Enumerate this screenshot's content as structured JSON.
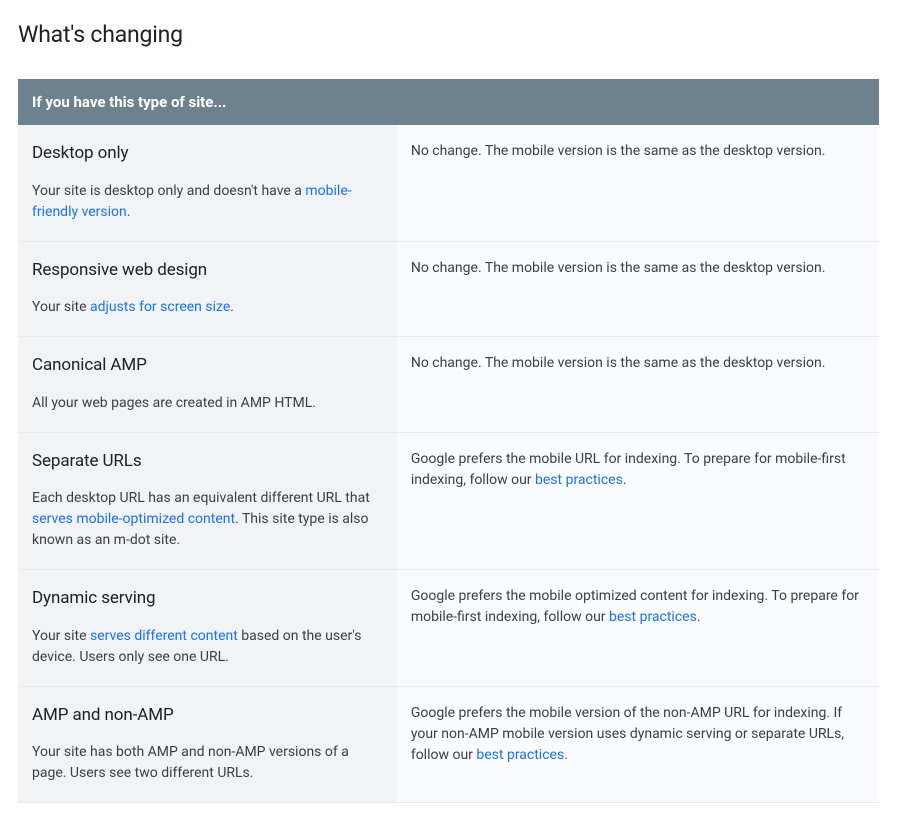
{
  "heading": "What's changing",
  "table_header": "If you have this type of site...",
  "rows": [
    {
      "title": "Desktop only",
      "desc_pre": "Your site is desktop only and doesn't have a ",
      "desc_link": "mobile-friendly version",
      "desc_post": ".",
      "right_pre": "No change. The mobile version is the same as the desktop version.",
      "right_link": "",
      "right_post": ""
    },
    {
      "title": "Responsive web design",
      "desc_pre": "Your site ",
      "desc_link": "adjusts for screen size",
      "desc_post": ".",
      "right_pre": "No change. The mobile version is the same as the desktop version.",
      "right_link": "",
      "right_post": ""
    },
    {
      "title": "Canonical AMP",
      "desc_pre": "All your web pages are created in AMP HTML.",
      "desc_link": "",
      "desc_post": "",
      "right_pre": "No change. The mobile version is the same as the desktop version.",
      "right_link": "",
      "right_post": ""
    },
    {
      "title": "Separate URLs",
      "desc_pre": "Each desktop URL has an equivalent different URL that ",
      "desc_link": "serves mobile-optimized content",
      "desc_post": ". This site type is also known as an m-dot site.",
      "right_pre": "Google prefers the mobile URL for indexing. To prepare for mobile-first indexing, follow our ",
      "right_link": "best practices",
      "right_post": "."
    },
    {
      "title": "Dynamic serving",
      "desc_pre": "Your site ",
      "desc_link": "serves different content",
      "desc_post": " based on the user's device. Users only see one URL.",
      "right_pre": "Google prefers the mobile optimized content for indexing. To prepare for mobile-first indexing, follow our ",
      "right_link": "best practices",
      "right_post": "."
    },
    {
      "title": "AMP and non-AMP",
      "desc_pre": "Your site has both AMP and non-AMP versions of a page. Users see two different URLs.",
      "desc_link": "",
      "desc_post": "",
      "right_pre": "Google prefers the mobile version of the non-AMP URL for indexing. If your non-AMP mobile version uses dynamic serving or separate URLs, follow our ",
      "right_link": "best practices",
      "right_post": "."
    }
  ]
}
